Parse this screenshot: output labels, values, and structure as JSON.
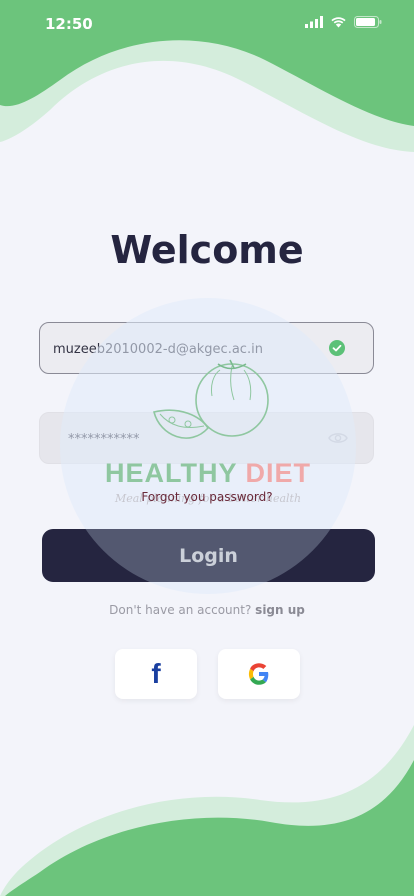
{
  "status_bar": {
    "time": "12:50"
  },
  "title": "Welcome",
  "email": {
    "value": "muzeeb2010002-d@akgec.ac.in",
    "valid_icon": "check-circle-icon"
  },
  "password": {
    "value": "***********",
    "toggle_icon": "eye-icon"
  },
  "watermark": {
    "title_part1": "HEALTHY",
    "title_part2": "DIET",
    "tagline": "Meal planning for a better health"
  },
  "forgot_label": "Forgot you password?",
  "login_label": "Login",
  "signup": {
    "prompt": "Don't have an account?",
    "link": "sign up"
  },
  "social": [
    {
      "name": "facebook-icon"
    },
    {
      "name": "google-icon"
    }
  ],
  "colors": {
    "green": "#6cc47c",
    "light_green": "#d4eddc",
    "dark": "#252540",
    "background": "#f3f4fa"
  }
}
